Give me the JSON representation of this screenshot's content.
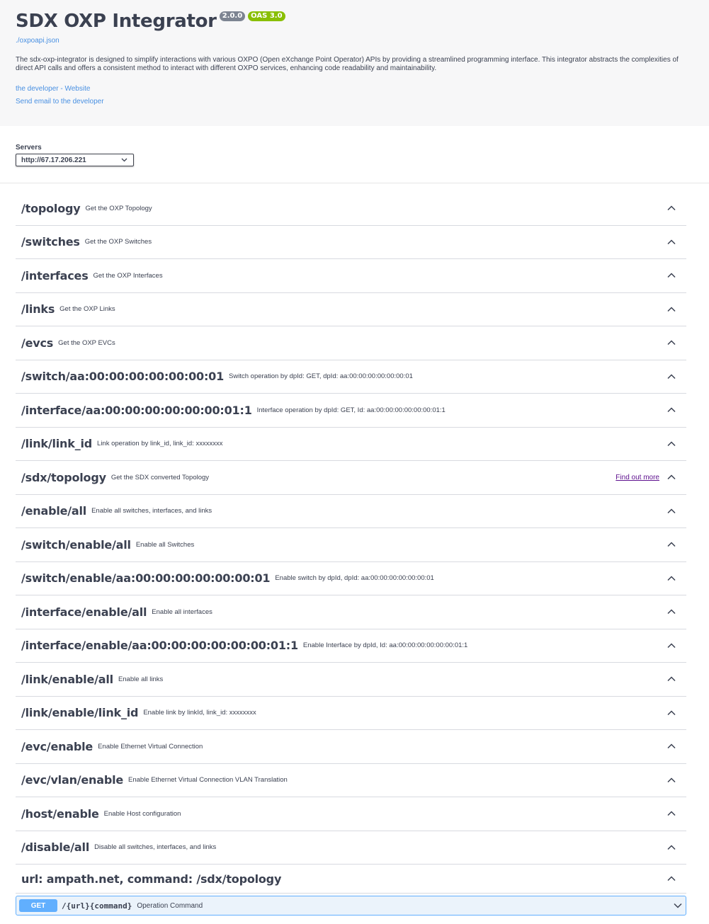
{
  "info": {
    "title": "SDX OXP Integrator",
    "version": "2.0.0",
    "oas_version": "OAS 3.0",
    "spec_url": "./oxpoapi.json",
    "description": "The sdx-oxp-integrator is designed to simplify interactions with various OXPO (Open eXchange Point Operator) APIs by providing a streamlined programming interface. This integrator abstracts the complexities of direct API calls and offers a consistent method to interact with different OXPO services, enhancing code readability and maintainability.",
    "contact_website": "the developer - Website",
    "contact_email": "Send email to the developer"
  },
  "servers": {
    "label": "Servers",
    "selected": "http://67.17.206.221"
  },
  "tags": [
    {
      "name": "/topology",
      "description": "Get the OXP Topology"
    },
    {
      "name": "/switches",
      "description": "Get the OXP Switches"
    },
    {
      "name": "/interfaces",
      "description": "Get the OXP Interfaces"
    },
    {
      "name": "/links",
      "description": "Get the OXP Links"
    },
    {
      "name": "/evcs",
      "description": "Get the OXP EVCs"
    },
    {
      "name": "/switch/aa:00:00:00:00:00:00:01",
      "description": "Switch operation by dpId: GET, dpId: aa:00:00:00:00:00:00:01"
    },
    {
      "name": "/interface/aa:00:00:00:00:00:00:01:1",
      "description": "Interface operation by dpId: GET, Id: aa:00:00:00:00:00:00:01:1"
    },
    {
      "name": "/link/link_id",
      "description": "Link operation by link_id, link_id: xxxxxxxx"
    },
    {
      "name": "/sdx/topology",
      "description": "Get the SDX converted Topology",
      "extra": "Find out more"
    },
    {
      "name": "/enable/all",
      "description": "Enable all switches, interfaces, and links"
    },
    {
      "name": "/switch/enable/all",
      "description": "Enable all Switches"
    },
    {
      "name": "/switch/enable/aa:00:00:00:00:00:00:01",
      "description": "Enable switch by dpId, dpId: aa:00:00:00:00:00:00:01"
    },
    {
      "name": "/interface/enable/all",
      "description": "Enable all interfaces"
    },
    {
      "name": "/interface/enable/aa:00:00:00:00:00:00:01:1",
      "description": "Enable Interface by dpId, Id: aa:00:00:00:00:00:00:01:1"
    },
    {
      "name": "/link/enable/all",
      "description": "Enable all links"
    },
    {
      "name": "/link/enable/link_id",
      "description": "Enable link by linkId, link_id: xxxxxxxx"
    },
    {
      "name": "/evc/enable",
      "description": "Enable Ethernet Virtual Connection"
    },
    {
      "name": "/evc/vlan/enable",
      "description": "Enable Ethernet Virtual Connection VLAN Translation"
    },
    {
      "name": "/host/enable",
      "description": "Enable Host configuration"
    },
    {
      "name": "/disable/all",
      "description": "Disable all switches, interfaces, and links"
    },
    {
      "name": "url: ampath.net, command: /sdx/topology",
      "description": ""
    }
  ],
  "operation": {
    "method": "GET",
    "path": "/{url}{command}",
    "summary": "Operation Command"
  },
  "colors": {
    "get_blue": "#61affe",
    "get_bg": "#ebf3fb",
    "badge_gray": "#7d8492",
    "badge_green": "#89bf04",
    "link_blue": "#4990e2",
    "external_link_purple": "#5d0f8e"
  }
}
